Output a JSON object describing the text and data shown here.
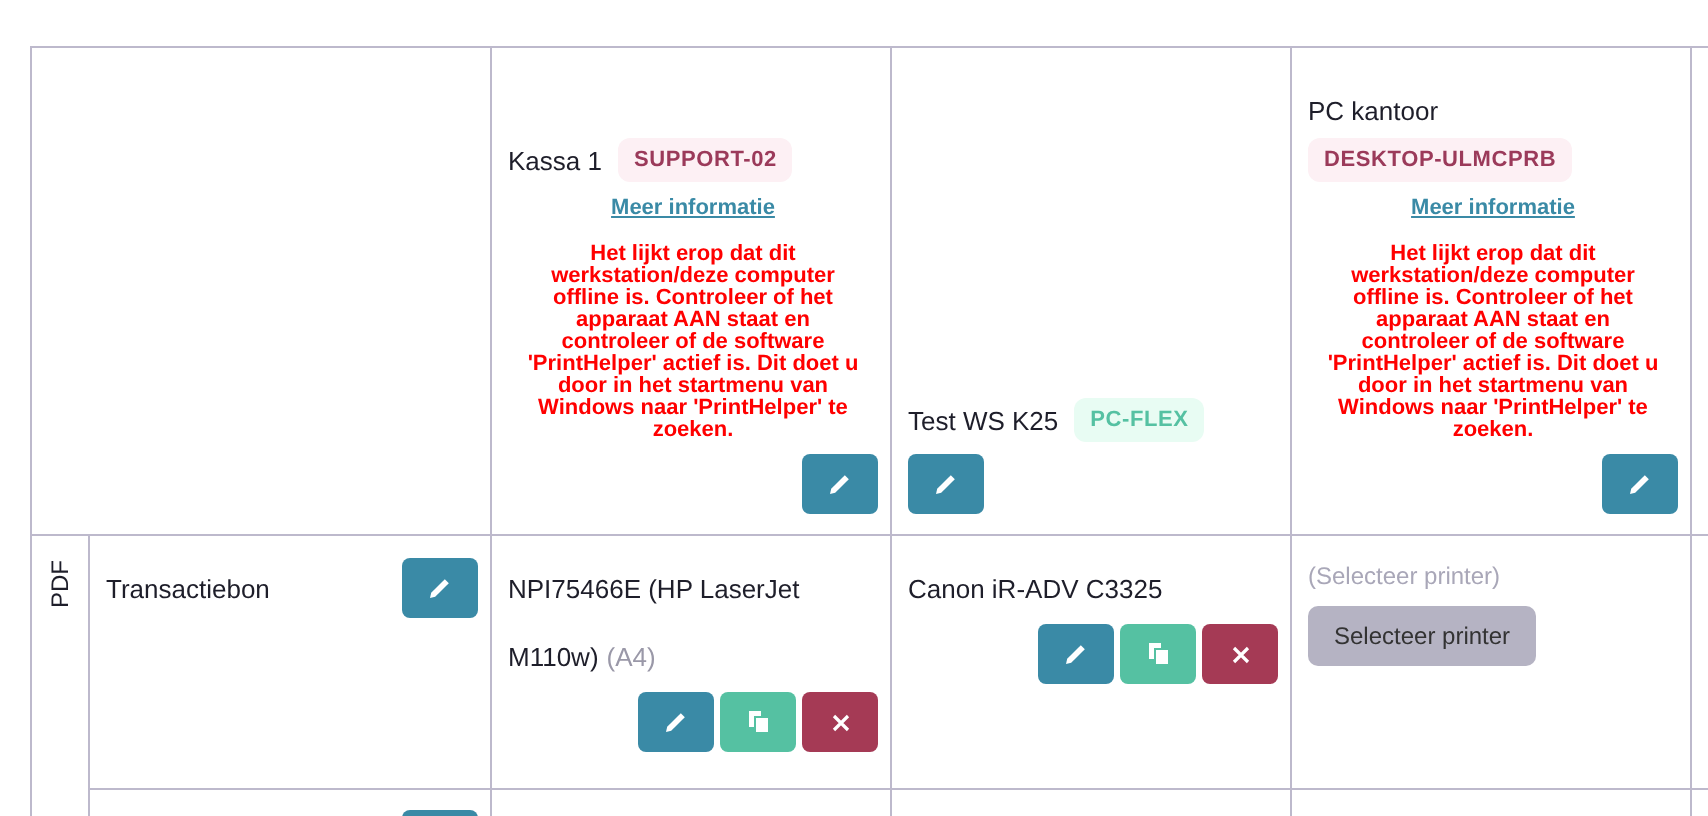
{
  "workstations": [
    {
      "name": "Kassa 1",
      "badge": "SUPPORT-02",
      "color": "#fdf0f4",
      "link": "Meer informatie",
      "warning": "Het lijkt erop dat dit werkstation/deze computer offline is. Controleer of het apparaat AAN staat en controleer of de software 'PrintHelper' actief is. Dit doet u door in het startmenu van Windows naar 'PrintHelper' te zoeken."
    },
    {
      "name": "Test WS K25",
      "badge": "PC-FLEX",
      "color": "#e8fcf3"
    },
    {
      "name": "PC kantoor",
      "badge": "DESKTOP-ULMCPRB",
      "color": "#fdf0f4",
      "link": "Meer informatie",
      "warning": "Het lijkt erop dat dit werkstation/deze computer offline is. Controleer of het apparaat AAN staat en controleer of de software 'PrintHelper' actief is. Dit doet u door in het startmenu van Windows naar 'PrintHelper' te zoeken."
    }
  ],
  "group": "PDF",
  "rows": [
    {
      "kind": "document",
      "name": "Transactiebon",
      "cells": [
        {
          "kind": "printer",
          "printer": "NPI75466E (HP LaserJet M110w)",
          "paper": "(A4)"
        },
        {
          "kind": "printer",
          "printer": "Canon iR-ADV C3325"
        },
        {
          "kind": "empty",
          "placeholder": "(Selecteer printer)",
          "button": "Selecteer printer"
        }
      ]
    },
    {
      "kind": "cut"
    }
  ]
}
